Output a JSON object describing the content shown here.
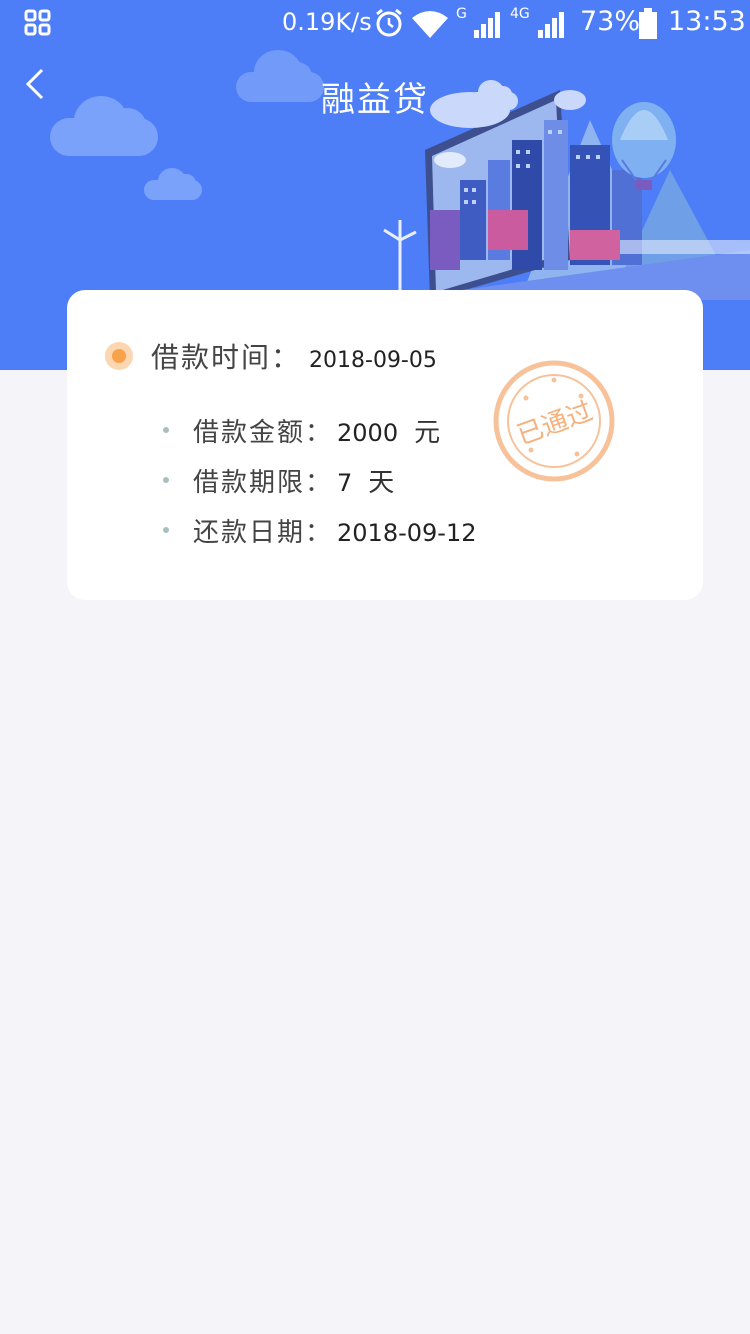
{
  "status_bar": {
    "network_speed": "0.19K/s",
    "signal1_label": "G",
    "signal2_label": "4G",
    "battery": "73%",
    "time": "13:53"
  },
  "nav": {
    "title": "融益贷"
  },
  "loan": {
    "time_label": "借款时间：",
    "time_value": "2018-09-05",
    "amount_label": "借款金额：",
    "amount_value": "2000",
    "amount_unit": "元",
    "term_label": "借款期限：",
    "term_value": "7",
    "term_unit": "天",
    "repay_label": "还款日期：",
    "repay_value": "2018-09-12",
    "stamp_text": "已通过"
  },
  "colors": {
    "header": "#4d7ef7",
    "background": "#f5f4f8",
    "accent_orange": "#f9a24c"
  }
}
